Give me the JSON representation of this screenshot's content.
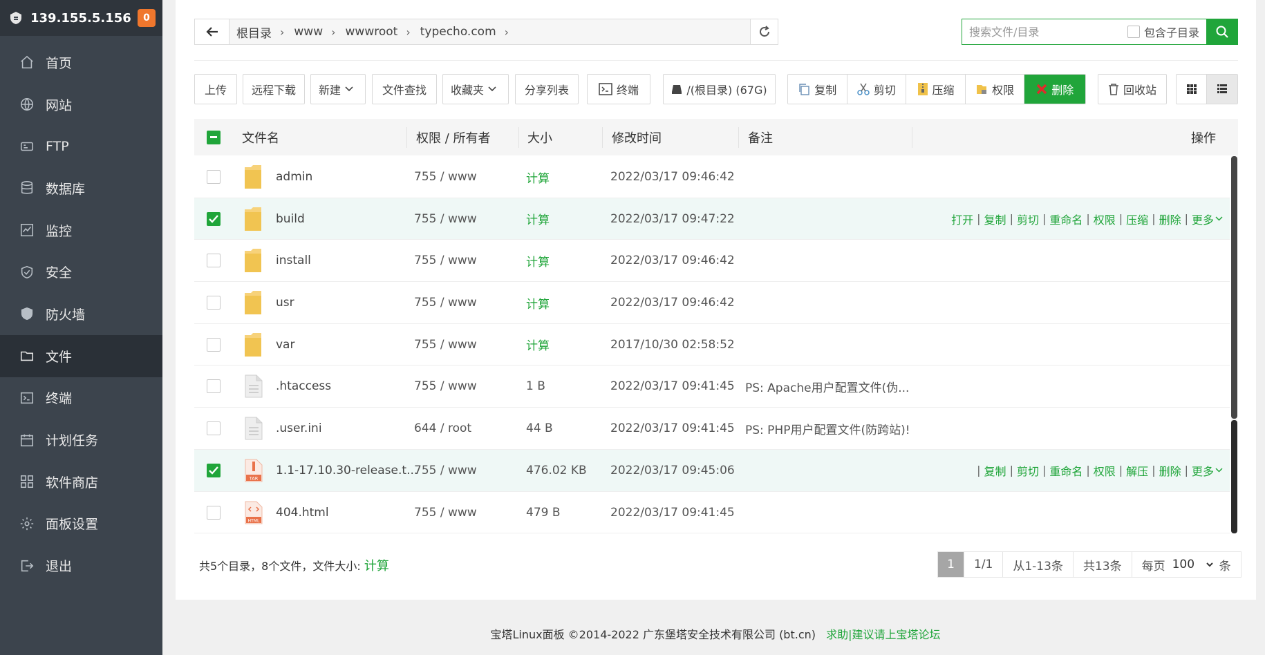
{
  "sidebar": {
    "ip": "139.155.5.156",
    "badge": "0",
    "items": [
      {
        "label": "首页",
        "icon": "home-icon"
      },
      {
        "label": "网站",
        "icon": "globe-icon"
      },
      {
        "label": "FTP",
        "icon": "ftp-icon"
      },
      {
        "label": "数据库",
        "icon": "database-icon"
      },
      {
        "label": "监控",
        "icon": "monitor-icon"
      },
      {
        "label": "安全",
        "icon": "shield-check-icon"
      },
      {
        "label": "防火墙",
        "icon": "firewall-icon"
      },
      {
        "label": "文件",
        "icon": "folder-icon"
      },
      {
        "label": "终端",
        "icon": "terminal-icon"
      },
      {
        "label": "计划任务",
        "icon": "calendar-icon"
      },
      {
        "label": "软件商店",
        "icon": "apps-icon"
      },
      {
        "label": "面板设置",
        "icon": "gear-icon"
      },
      {
        "label": "退出",
        "icon": "logout-icon"
      }
    ],
    "active_index": 7
  },
  "path": {
    "crumbs": [
      "根目录",
      "www",
      "wwwroot",
      "typecho.com"
    ]
  },
  "search": {
    "placeholder": "搜索文件/目录",
    "include_sub_label": "包含子目录"
  },
  "toolbar": {
    "upload": "上传",
    "remote_download": "远程下载",
    "new": "新建",
    "find": "文件查找",
    "favorites": "收藏夹",
    "share_list": "分享列表",
    "terminal": "终端",
    "disk": "/(根目录) (67G)",
    "copy": "复制",
    "cut": "剪切",
    "compress": "压缩",
    "permission": "权限",
    "delete": "删除",
    "recycle": "回收站"
  },
  "table": {
    "headers": {
      "name": "文件名",
      "perm": "权限 / 所有者",
      "size": "大小",
      "mtime": "修改时间",
      "note": "备注",
      "ops": "操作"
    },
    "rows": [
      {
        "name": "admin",
        "type": "folder",
        "perm": "755 / www",
        "size": "计算",
        "size_link": true,
        "mtime": "2022/03/17 09:46:42",
        "note": "",
        "selected": false
      },
      {
        "name": "build",
        "type": "folder",
        "perm": "755 / www",
        "size": "计算",
        "size_link": true,
        "mtime": "2022/03/17 09:47:22",
        "note": "",
        "selected": true,
        "ops": [
          "打开",
          "复制",
          "剪切",
          "重命名",
          "权限",
          "压缩",
          "删除",
          "更多"
        ]
      },
      {
        "name": "install",
        "type": "folder",
        "perm": "755 / www",
        "size": "计算",
        "size_link": true,
        "mtime": "2022/03/17 09:46:42",
        "note": "",
        "selected": false
      },
      {
        "name": "usr",
        "type": "folder",
        "perm": "755 / www",
        "size": "计算",
        "size_link": true,
        "mtime": "2022/03/17 09:46:42",
        "note": "",
        "selected": false
      },
      {
        "name": "var",
        "type": "folder",
        "perm": "755 / www",
        "size": "计算",
        "size_link": true,
        "mtime": "2017/10/30 02:58:52",
        "note": "",
        "selected": false
      },
      {
        "name": ".htaccess",
        "type": "file",
        "perm": "755 / www",
        "size": "1 B",
        "size_link": false,
        "mtime": "2022/03/17 09:41:45",
        "note": "PS: Apache用户配置文件(伪...",
        "selected": false
      },
      {
        "name": ".user.ini",
        "type": "file",
        "perm": "644 / root",
        "size": "44 B",
        "size_link": false,
        "mtime": "2022/03/17 09:41:45",
        "note": "PS: PHP用户配置文件(防跨站)!",
        "selected": false
      },
      {
        "name": "1.1-17.10.30-release.t...",
        "type": "tar",
        "perm": "755 / www",
        "size": "476.02 KB",
        "size_link": false,
        "mtime": "2022/03/17 09:45:06",
        "note": "",
        "selected": true,
        "ops": [
          "",
          "复制",
          "剪切",
          "重命名",
          "权限",
          "解压",
          "删除",
          "更多"
        ]
      },
      {
        "name": "404.html",
        "type": "html",
        "perm": "755 / www",
        "size": "479 B",
        "size_link": false,
        "mtime": "2022/03/17 09:41:45",
        "note": "",
        "selected": false
      }
    ]
  },
  "summary": {
    "text": "共5个目录，8个文件，文件大小: ",
    "link": "计算"
  },
  "pager": {
    "current": "1",
    "pages": "1/1",
    "range": "从1-13条",
    "total": "共13条",
    "per_page_label": "每页",
    "per_page_value": "100",
    "unit": "条"
  },
  "footer": {
    "text": "宝塔Linux面板 ©2014-2022 广东堡塔安全技术有限公司 (bt.cn)",
    "link": "求助|建议请上宝塔论坛"
  },
  "colors": {
    "accent": "#20a53a",
    "sidebar_bg": "#3c444d",
    "badge": "#f0772d"
  }
}
